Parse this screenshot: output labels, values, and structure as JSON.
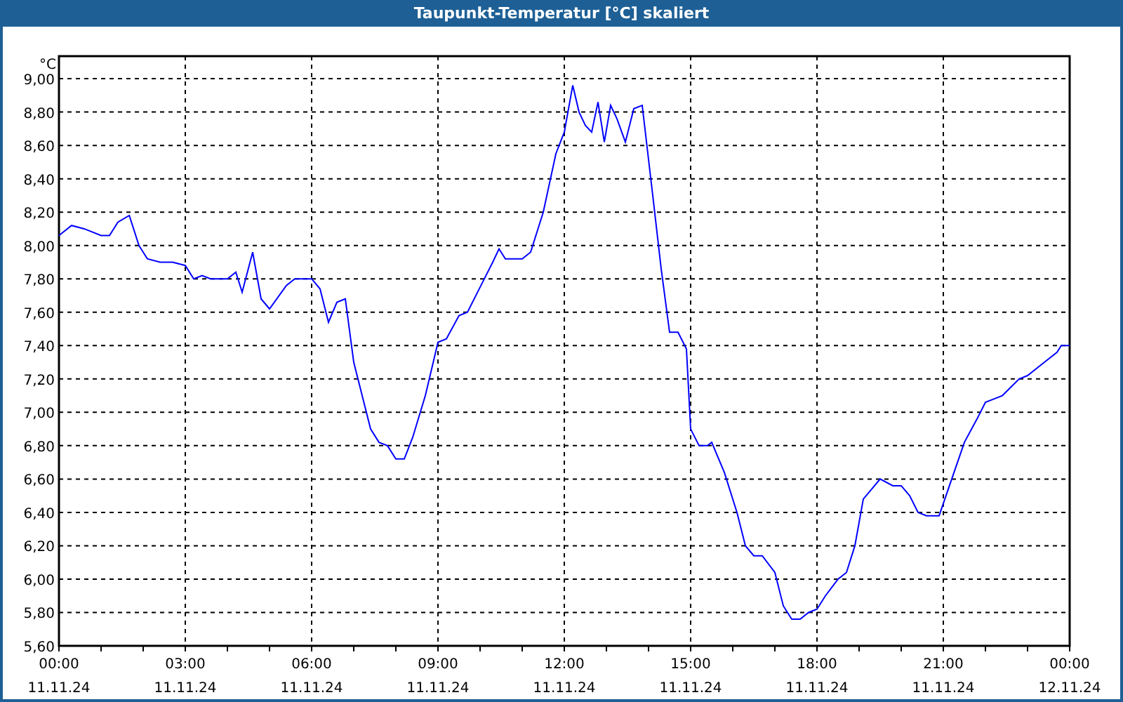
{
  "window": {
    "title": "Taupunkt-Temperatur [°C] skaliert"
  },
  "chart": {
    "tick_dates": [
      "11.11.24",
      "11.11.24",
      "11.11.24",
      "11.11.24",
      "11.11.24",
      "11.11.24",
      "11.11.24",
      "11.11.24",
      "12.11.24"
    ],
    "chart_data": {
      "type": "line",
      "grid": true,
      "ylabel": "°C",
      "xlim": [
        0,
        24
      ],
      "ylim": [
        5.6,
        9.135
      ],
      "xticks": [
        {
          "value": 0,
          "label": "00:00"
        },
        {
          "value": 3,
          "label": "03:00"
        },
        {
          "value": 6,
          "label": "06:00"
        },
        {
          "value": 9,
          "label": "09:00"
        },
        {
          "value": 12,
          "label": "12:00"
        },
        {
          "value": 15,
          "label": "15:00"
        },
        {
          "value": 18,
          "label": "18:00"
        },
        {
          "value": 21,
          "label": "21:00"
        },
        {
          "value": 24,
          "label": "00:00"
        }
      ],
      "yticks": [
        {
          "value": 5.6,
          "label": "5,60"
        },
        {
          "value": 5.8,
          "label": "5,80"
        },
        {
          "value": 6.0,
          "label": "6,00"
        },
        {
          "value": 6.2,
          "label": "6,20"
        },
        {
          "value": 6.4,
          "label": "6,40"
        },
        {
          "value": 6.6,
          "label": "6,60"
        },
        {
          "value": 6.8,
          "label": "6,80"
        },
        {
          "value": 7.0,
          "label": "7,00"
        },
        {
          "value": 7.2,
          "label": "7,20"
        },
        {
          "value": 7.4,
          "label": "7,40"
        },
        {
          "value": 7.6,
          "label": "7,60"
        },
        {
          "value": 7.8,
          "label": "7,80"
        },
        {
          "value": 8.0,
          "label": "8,00"
        },
        {
          "value": 8.2,
          "label": "8,20"
        },
        {
          "value": 8.4,
          "label": "8,40"
        },
        {
          "value": 8.6,
          "label": "8,60"
        },
        {
          "value": 8.8,
          "label": "8,80"
        },
        {
          "value": 9.0,
          "label": "9,00"
        }
      ],
      "x": [
        0,
        0.3,
        0.6,
        1.0,
        1.2,
        1.4,
        1.67,
        1.9,
        2.1,
        2.4,
        2.7,
        3.0,
        3.2,
        3.4,
        3.6,
        4.0,
        4.2,
        4.35,
        4.6,
        4.8,
        5.0,
        5.4,
        5.6,
        6.0,
        6.2,
        6.4,
        6.6,
        6.8,
        7.0,
        7.2,
        7.4,
        7.6,
        7.8,
        8.0,
        8.2,
        8.4,
        8.7,
        9.0,
        9.2,
        9.5,
        9.7,
        10.0,
        10.3,
        10.45,
        10.6,
        11.0,
        11.2,
        11.5,
        11.8,
        12.0,
        12.2,
        12.35,
        12.5,
        12.65,
        12.8,
        12.95,
        13.1,
        13.25,
        13.45,
        13.65,
        13.85,
        14.1,
        14.3,
        14.5,
        14.7,
        14.9,
        15.0,
        15.2,
        15.4,
        15.5,
        15.8,
        16.1,
        16.3,
        16.5,
        16.7,
        17.0,
        17.2,
        17.4,
        17.6,
        17.8,
        18.0,
        18.2,
        18.5,
        18.7,
        18.9,
        19.1,
        19.3,
        19.5,
        19.8,
        20.0,
        20.2,
        20.4,
        20.6,
        20.9,
        21.2,
        21.5,
        21.8,
        22.0,
        22.2,
        22.4,
        22.8,
        23.0,
        23.3,
        23.7,
        23.8,
        24.0
      ],
      "series": [
        {
          "color": "#0000ff",
          "values": [
            8.06,
            8.12,
            8.1,
            8.06,
            8.06,
            8.14,
            8.18,
            8.0,
            7.92,
            7.9,
            7.9,
            7.88,
            7.8,
            7.82,
            7.8,
            7.8,
            7.84,
            7.72,
            7.96,
            7.68,
            7.62,
            7.76,
            7.8,
            7.8,
            7.74,
            7.54,
            7.66,
            7.68,
            7.3,
            7.1,
            6.9,
            6.82,
            6.8,
            6.72,
            6.72,
            6.85,
            7.1,
            7.42,
            7.44,
            7.58,
            7.6,
            7.75,
            7.9,
            7.98,
            7.92,
            7.92,
            7.96,
            8.2,
            8.55,
            8.68,
            8.96,
            8.8,
            8.72,
            8.68,
            8.86,
            8.62,
            8.84,
            8.76,
            8.62,
            8.82,
            8.84,
            8.3,
            7.86,
            7.48,
            7.48,
            7.38,
            6.9,
            6.8,
            6.8,
            6.82,
            6.64,
            6.4,
            6.2,
            6.14,
            6.14,
            6.04,
            5.84,
            5.76,
            5.76,
            5.8,
            5.82,
            5.9,
            6.0,
            6.04,
            6.2,
            6.48,
            6.54,
            6.6,
            6.56,
            6.56,
            6.5,
            6.4,
            6.38,
            6.38,
            6.6,
            6.82,
            6.96,
            7.06,
            7.08,
            7.1,
            7.2,
            7.22,
            7.28,
            7.36,
            7.4,
            7.4
          ]
        }
      ]
    }
  }
}
